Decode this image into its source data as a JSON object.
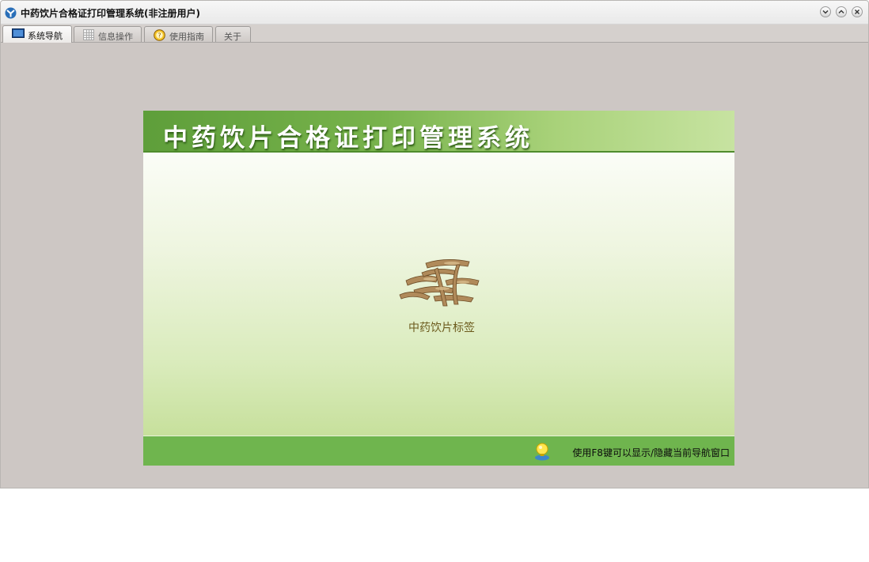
{
  "window": {
    "title": "中药饮片合格证打印管理系统(非注册用户)",
    "icon": "app-logo-icon",
    "controls": [
      "minimize-icon",
      "maximize-icon",
      "close-icon"
    ]
  },
  "tabs": [
    {
      "label": "系统导航",
      "icon": "monitor-icon",
      "active": true
    },
    {
      "label": "信息操作",
      "icon": "grid-icon",
      "active": false
    },
    {
      "label": "使用指南",
      "icon": "help-icon",
      "active": false
    },
    {
      "label": "关于",
      "icon": "",
      "active": false
    }
  ],
  "panel": {
    "banner_title": "中药饮片合格证打印管理系统",
    "modules": [
      {
        "label": "中药饮片标签",
        "icon": "herbal-slices-icon"
      }
    ],
    "footer_tip": "使用F8键可以显示/隐藏当前导航窗口",
    "footer_icon": "lightbulb-user-icon"
  },
  "colors": {
    "window_background": "#cdc7c4",
    "banner_green": "#78b34c",
    "footer_green": "#6fb54e",
    "module_label": "#6b5a1c"
  }
}
